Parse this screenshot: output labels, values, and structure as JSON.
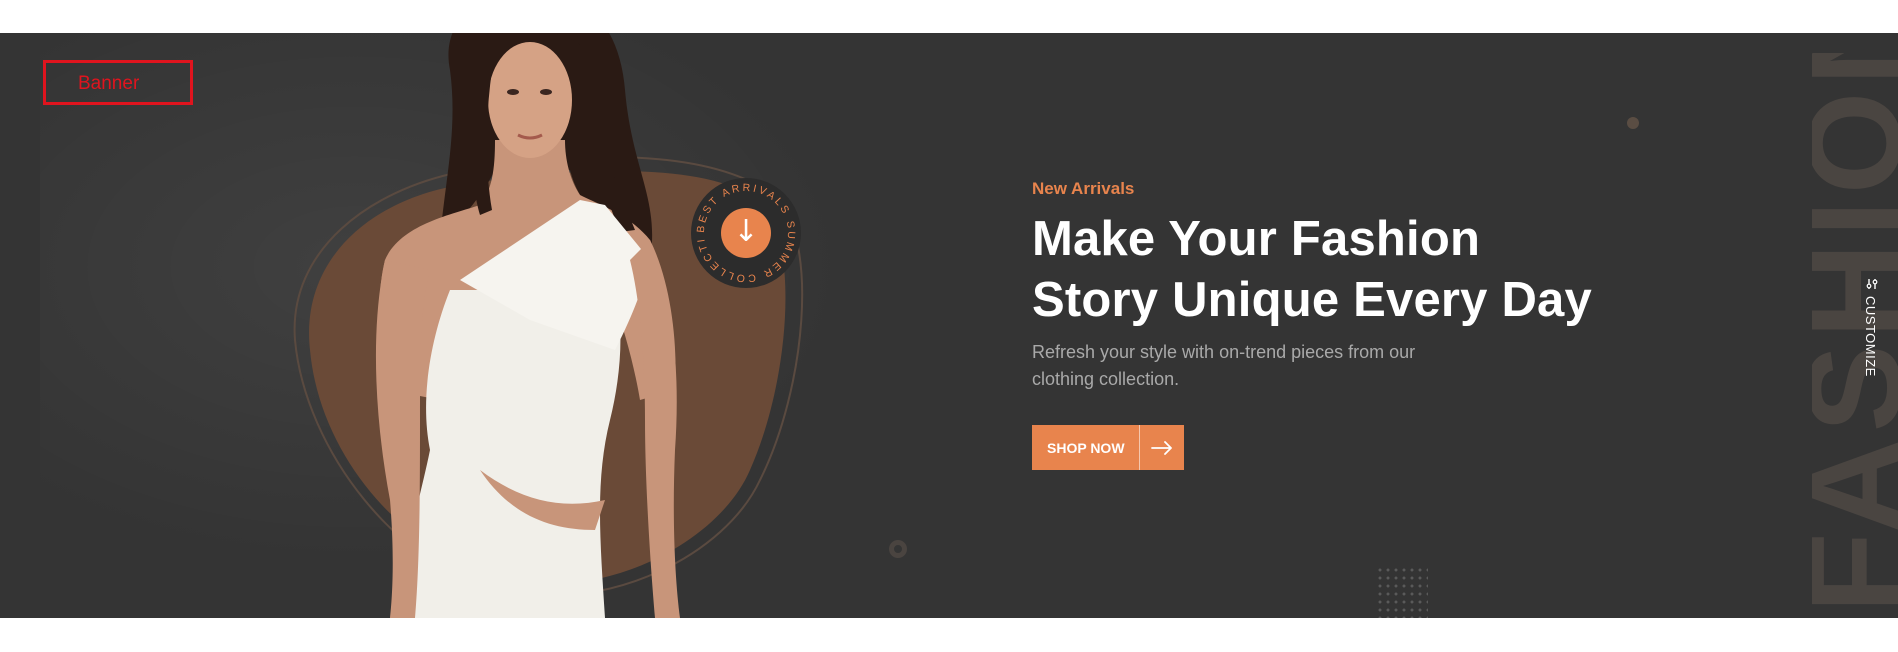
{
  "annotation": {
    "label": "Banner",
    "color": "#e0141e"
  },
  "banner": {
    "background_color": "#343434",
    "accent_color": "#e8844d",
    "eyebrow": "New Arrivals",
    "headline_line1": "Make Your Fashion",
    "headline_line2": "Story Unique Every Day",
    "subtitle": "Refresh your style with on-trend pieces from our clothing collection.",
    "button_label": "SHOP NOW",
    "button_icon": "arrow-right-icon",
    "badge_ring_text": "BEST ARRIVALS SUMMER COLLECTION",
    "badge_icon": "arrow-down-icon",
    "watermark": "FASHION",
    "image": "model-in-white-dress"
  },
  "sidebar": {
    "customize_label": "CUSTOMIZE",
    "customize_icon": "sliders-icon"
  }
}
